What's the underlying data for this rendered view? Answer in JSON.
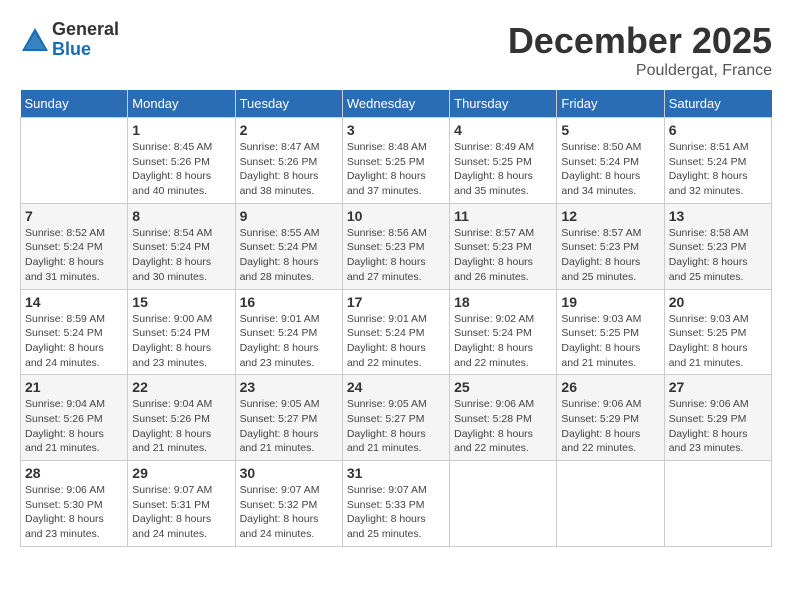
{
  "header": {
    "logo": {
      "general": "General",
      "blue": "Blue"
    },
    "title": "December 2025",
    "location": "Pouldergat, France"
  },
  "weekdays": [
    "Sunday",
    "Monday",
    "Tuesday",
    "Wednesday",
    "Thursday",
    "Friday",
    "Saturday"
  ],
  "weeks": [
    [
      {
        "day": "",
        "sunrise": "",
        "sunset": "",
        "daylight": ""
      },
      {
        "day": "1",
        "sunrise": "Sunrise: 8:45 AM",
        "sunset": "Sunset: 5:26 PM",
        "daylight": "Daylight: 8 hours and 40 minutes."
      },
      {
        "day": "2",
        "sunrise": "Sunrise: 8:47 AM",
        "sunset": "Sunset: 5:26 PM",
        "daylight": "Daylight: 8 hours and 38 minutes."
      },
      {
        "day": "3",
        "sunrise": "Sunrise: 8:48 AM",
        "sunset": "Sunset: 5:25 PM",
        "daylight": "Daylight: 8 hours and 37 minutes."
      },
      {
        "day": "4",
        "sunrise": "Sunrise: 8:49 AM",
        "sunset": "Sunset: 5:25 PM",
        "daylight": "Daylight: 8 hours and 35 minutes."
      },
      {
        "day": "5",
        "sunrise": "Sunrise: 8:50 AM",
        "sunset": "Sunset: 5:24 PM",
        "daylight": "Daylight: 8 hours and 34 minutes."
      },
      {
        "day": "6",
        "sunrise": "Sunrise: 8:51 AM",
        "sunset": "Sunset: 5:24 PM",
        "daylight": "Daylight: 8 hours and 32 minutes."
      }
    ],
    [
      {
        "day": "7",
        "sunrise": "Sunrise: 8:52 AM",
        "sunset": "Sunset: 5:24 PM",
        "daylight": "Daylight: 8 hours and 31 minutes."
      },
      {
        "day": "8",
        "sunrise": "Sunrise: 8:54 AM",
        "sunset": "Sunset: 5:24 PM",
        "daylight": "Daylight: 8 hours and 30 minutes."
      },
      {
        "day": "9",
        "sunrise": "Sunrise: 8:55 AM",
        "sunset": "Sunset: 5:24 PM",
        "daylight": "Daylight: 8 hours and 28 minutes."
      },
      {
        "day": "10",
        "sunrise": "Sunrise: 8:56 AM",
        "sunset": "Sunset: 5:23 PM",
        "daylight": "Daylight: 8 hours and 27 minutes."
      },
      {
        "day": "11",
        "sunrise": "Sunrise: 8:57 AM",
        "sunset": "Sunset: 5:23 PM",
        "daylight": "Daylight: 8 hours and 26 minutes."
      },
      {
        "day": "12",
        "sunrise": "Sunrise: 8:57 AM",
        "sunset": "Sunset: 5:23 PM",
        "daylight": "Daylight: 8 hours and 25 minutes."
      },
      {
        "day": "13",
        "sunrise": "Sunrise: 8:58 AM",
        "sunset": "Sunset: 5:23 PM",
        "daylight": "Daylight: 8 hours and 25 minutes."
      }
    ],
    [
      {
        "day": "14",
        "sunrise": "Sunrise: 8:59 AM",
        "sunset": "Sunset: 5:24 PM",
        "daylight": "Daylight: 8 hours and 24 minutes."
      },
      {
        "day": "15",
        "sunrise": "Sunrise: 9:00 AM",
        "sunset": "Sunset: 5:24 PM",
        "daylight": "Daylight: 8 hours and 23 minutes."
      },
      {
        "day": "16",
        "sunrise": "Sunrise: 9:01 AM",
        "sunset": "Sunset: 5:24 PM",
        "daylight": "Daylight: 8 hours and 23 minutes."
      },
      {
        "day": "17",
        "sunrise": "Sunrise: 9:01 AM",
        "sunset": "Sunset: 5:24 PM",
        "daylight": "Daylight: 8 hours and 22 minutes."
      },
      {
        "day": "18",
        "sunrise": "Sunrise: 9:02 AM",
        "sunset": "Sunset: 5:24 PM",
        "daylight": "Daylight: 8 hours and 22 minutes."
      },
      {
        "day": "19",
        "sunrise": "Sunrise: 9:03 AM",
        "sunset": "Sunset: 5:25 PM",
        "daylight": "Daylight: 8 hours and 21 minutes."
      },
      {
        "day": "20",
        "sunrise": "Sunrise: 9:03 AM",
        "sunset": "Sunset: 5:25 PM",
        "daylight": "Daylight: 8 hours and 21 minutes."
      }
    ],
    [
      {
        "day": "21",
        "sunrise": "Sunrise: 9:04 AM",
        "sunset": "Sunset: 5:26 PM",
        "daylight": "Daylight: 8 hours and 21 minutes."
      },
      {
        "day": "22",
        "sunrise": "Sunrise: 9:04 AM",
        "sunset": "Sunset: 5:26 PM",
        "daylight": "Daylight: 8 hours and 21 minutes."
      },
      {
        "day": "23",
        "sunrise": "Sunrise: 9:05 AM",
        "sunset": "Sunset: 5:27 PM",
        "daylight": "Daylight: 8 hours and 21 minutes."
      },
      {
        "day": "24",
        "sunrise": "Sunrise: 9:05 AM",
        "sunset": "Sunset: 5:27 PM",
        "daylight": "Daylight: 8 hours and 21 minutes."
      },
      {
        "day": "25",
        "sunrise": "Sunrise: 9:06 AM",
        "sunset": "Sunset: 5:28 PM",
        "daylight": "Daylight: 8 hours and 22 minutes."
      },
      {
        "day": "26",
        "sunrise": "Sunrise: 9:06 AM",
        "sunset": "Sunset: 5:29 PM",
        "daylight": "Daylight: 8 hours and 22 minutes."
      },
      {
        "day": "27",
        "sunrise": "Sunrise: 9:06 AM",
        "sunset": "Sunset: 5:29 PM",
        "daylight": "Daylight: 8 hours and 23 minutes."
      }
    ],
    [
      {
        "day": "28",
        "sunrise": "Sunrise: 9:06 AM",
        "sunset": "Sunset: 5:30 PM",
        "daylight": "Daylight: 8 hours and 23 minutes."
      },
      {
        "day": "29",
        "sunrise": "Sunrise: 9:07 AM",
        "sunset": "Sunset: 5:31 PM",
        "daylight": "Daylight: 8 hours and 24 minutes."
      },
      {
        "day": "30",
        "sunrise": "Sunrise: 9:07 AM",
        "sunset": "Sunset: 5:32 PM",
        "daylight": "Daylight: 8 hours and 24 minutes."
      },
      {
        "day": "31",
        "sunrise": "Sunrise: 9:07 AM",
        "sunset": "Sunset: 5:33 PM",
        "daylight": "Daylight: 8 hours and 25 minutes."
      },
      {
        "day": "",
        "sunrise": "",
        "sunset": "",
        "daylight": ""
      },
      {
        "day": "",
        "sunrise": "",
        "sunset": "",
        "daylight": ""
      },
      {
        "day": "",
        "sunrise": "",
        "sunset": "",
        "daylight": ""
      }
    ]
  ]
}
